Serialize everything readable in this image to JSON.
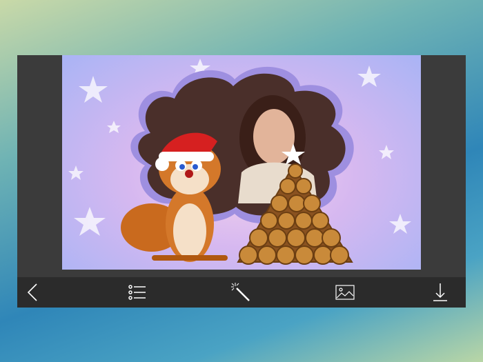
{
  "editor": {
    "canvas": {
      "frame": "squirrel-acorn-christmas-cloud-frame",
      "background_color": "#c8b8f2"
    },
    "toolbar": {
      "background_color": "#2b2b2b",
      "buttons": [
        {
          "name": "back",
          "icon": "chevron-left-icon"
        },
        {
          "name": "frames-list",
          "icon": "list-icon"
        },
        {
          "name": "effects",
          "icon": "magic-wand-icon"
        },
        {
          "name": "gallery",
          "icon": "image-icon"
        },
        {
          "name": "download",
          "icon": "download-icon"
        }
      ]
    }
  }
}
